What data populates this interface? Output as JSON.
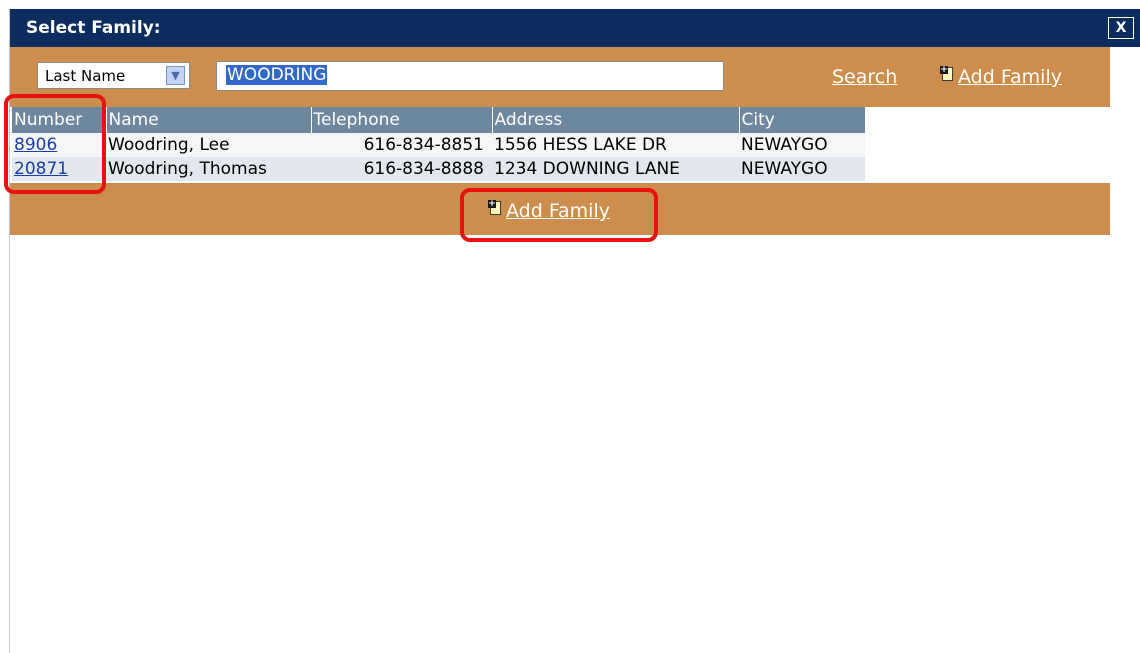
{
  "dialog": {
    "title": "Select Family:",
    "close_label": "X"
  },
  "search": {
    "field_select": "Last Name",
    "query": "WOODRING",
    "search_label": "Search",
    "add_family_label": "Add Family"
  },
  "table": {
    "headers": [
      "Number",
      "Name",
      "Telephone",
      "Address",
      "City"
    ],
    "rows": [
      {
        "number": "8906",
        "name": "Woodring, Lee",
        "telephone": "616-834-8851",
        "address": "1556 HESS LAKE DR",
        "city": "NEWAYGO"
      },
      {
        "number": "20871",
        "name": "Woodring, Thomas",
        "telephone": "616-834-8888",
        "address": "1234 DOWNING LANE",
        "city": "NEWAYGO"
      }
    ]
  },
  "footer": {
    "add_family_label": "Add Family"
  },
  "colors": {
    "titlebar": "#0b2c5e",
    "toolbar": "#cd8d4c",
    "table_header": "#6d879f",
    "highlight": "#e81010"
  },
  "icons": {
    "close": "close-icon",
    "dropdown": "chevron-down-icon",
    "add_family": "add-document-icon"
  }
}
